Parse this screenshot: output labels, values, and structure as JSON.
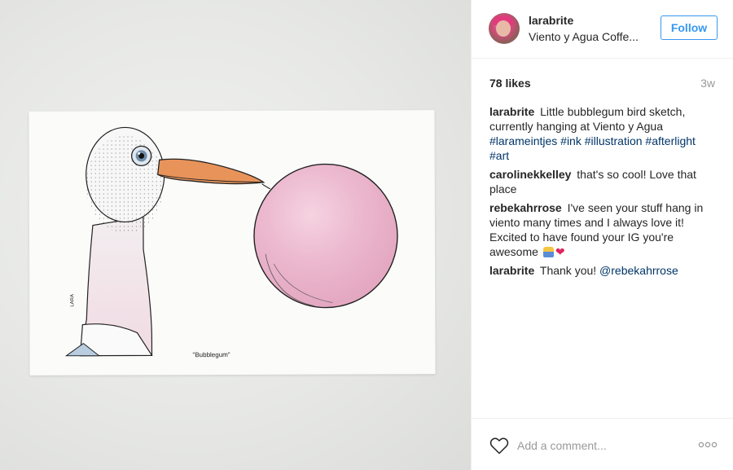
{
  "post": {
    "username": "larabrite",
    "location": "Viento y Agua Coffe...",
    "follow_label": "Follow",
    "likes": "78 likes",
    "age": "3w",
    "artwork_caption": "\"Bubblegum\"",
    "artwork_signature": "LARA"
  },
  "comments": [
    {
      "author": "larabrite",
      "text": "Little bubblegum bird sketch, currently hanging at Viento y Agua",
      "hashtags": "#larameintjes #ink #illustration #afterlight #art"
    },
    {
      "author": "carolinekkelley",
      "text": "that's so cool! Love that place"
    },
    {
      "author": "rebekahrrose",
      "text": "I've seen your stuff hang in viento many times and I always love it! Excited to have found your IG you're awesome",
      "emoji": "❤"
    },
    {
      "author": "larabrite",
      "text": "Thank you!",
      "mention": "@rebekahrrose"
    }
  ],
  "comment_bar": {
    "placeholder": "Add a comment..."
  },
  "icons": {
    "like": "heart-outline-icon",
    "more": "more-options-icon"
  },
  "colors": {
    "accent": "#3897f0",
    "hashtag": "#003569",
    "muted": "#999999"
  }
}
